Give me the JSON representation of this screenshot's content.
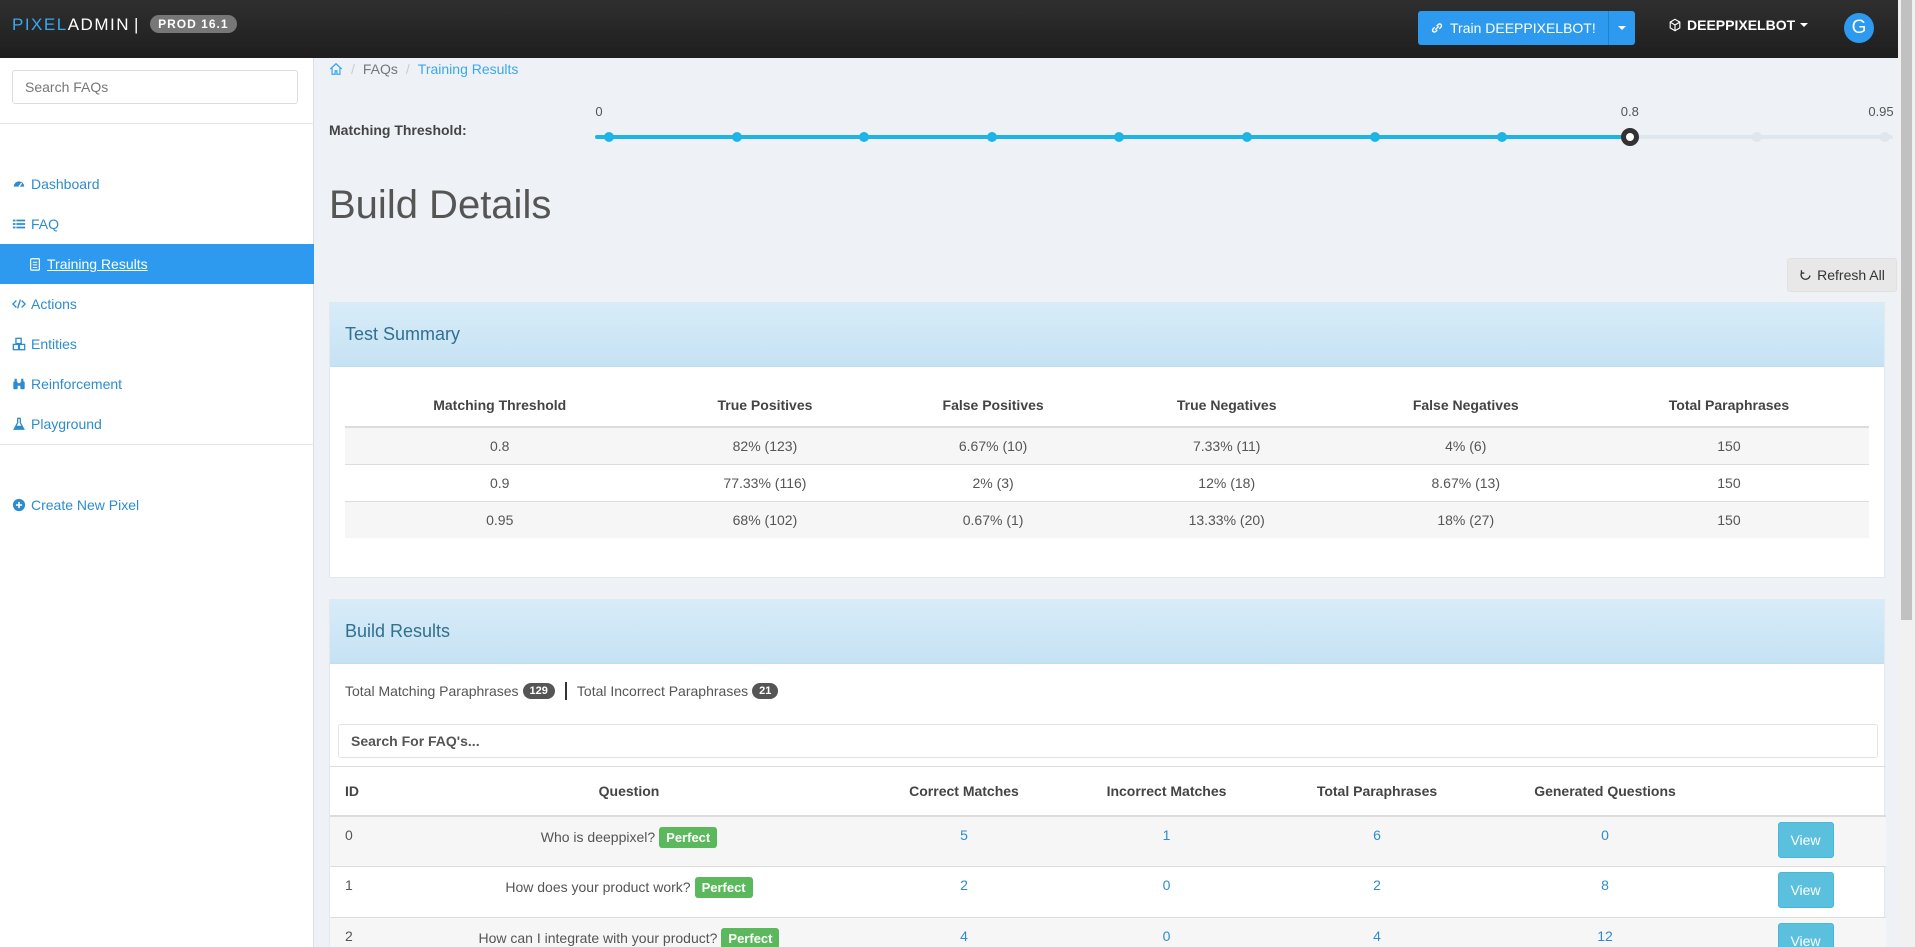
{
  "brand": {
    "part1": "PIXEL",
    "part2": "ADMIN",
    "sep": "|",
    "env": "PROD 16.1"
  },
  "header": {
    "train_label": "Train DEEPPIXELBOT!",
    "user_label": "DEEPPIXELBOT",
    "avatar_letter": "G"
  },
  "sidebar": {
    "search_placeholder": "Search FAQs",
    "items": [
      {
        "label": "Dashboard",
        "icon": "dashboard-icon"
      },
      {
        "label": "FAQ",
        "icon": "list-icon"
      },
      {
        "label": "Training Results",
        "icon": "clipboard-icon",
        "active": true
      },
      {
        "label": "Actions",
        "icon": "code-icon"
      },
      {
        "label": "Entities",
        "icon": "cubes-icon"
      },
      {
        "label": "Reinforcement",
        "icon": "binoculars-icon"
      },
      {
        "label": "Playground",
        "icon": "flask-icon"
      }
    ],
    "create_label": "Create New Pixel"
  },
  "breadcrumb": {
    "home_icon": "home-icon",
    "level1": "FAQs",
    "current": "Training Results"
  },
  "threshold": {
    "label": "Matching Threshold:",
    "min_label": "0",
    "value_label": "0.8",
    "max_label": "0.95",
    "steps": 11,
    "value_step": 8,
    "accent": "#1fb4e6"
  },
  "page_title": "Build Details",
  "refresh_label": "Refresh All",
  "summary": {
    "title": "Test Summary",
    "headers": [
      "Matching Threshold",
      "True Positives",
      "False Positives",
      "True Negatives",
      "False Negatives",
      "Total Paraphrases"
    ],
    "rows": [
      [
        "0.8",
        "82% (123)",
        "6.67% (10)",
        "7.33% (11)",
        "4% (6)",
        "150"
      ],
      [
        "0.9",
        "77.33% (116)",
        "2% (3)",
        "12% (18)",
        "8.67% (13)",
        "150"
      ],
      [
        "0.95",
        "68% (102)",
        "0.67% (1)",
        "13.33% (20)",
        "18% (27)",
        "150"
      ]
    ]
  },
  "results": {
    "title": "Build Results",
    "matching_label": "Total Matching Paraphrases",
    "matching_count": "129",
    "incorrect_label": "Total Incorrect Paraphrases",
    "incorrect_count": "21",
    "search_placeholder": "Search For FAQ's...",
    "headers": [
      "ID",
      "Question",
      "Correct Matches",
      "Incorrect Matches",
      "Total Paraphrases",
      "Generated Questions",
      ""
    ],
    "rows": [
      {
        "id": "0",
        "question": "Who is deeppixel?",
        "badge": "Perfect",
        "correct": "5",
        "incorrect": "1",
        "total": "6",
        "generated": "0",
        "action": "View"
      },
      {
        "id": "1",
        "question": "How does your product work?",
        "badge": "Perfect",
        "correct": "2",
        "incorrect": "0",
        "total": "2",
        "generated": "8",
        "action": "View"
      },
      {
        "id": "2",
        "question": "How can I integrate with your product?",
        "badge": "Perfect",
        "correct": "4",
        "incorrect": "0",
        "total": "4",
        "generated": "12",
        "action": "View"
      }
    ]
  },
  "colors": {
    "primary": "#2d9af0",
    "link": "#2d8ccf",
    "success": "#5cb85c",
    "info": "#5bc0de"
  }
}
